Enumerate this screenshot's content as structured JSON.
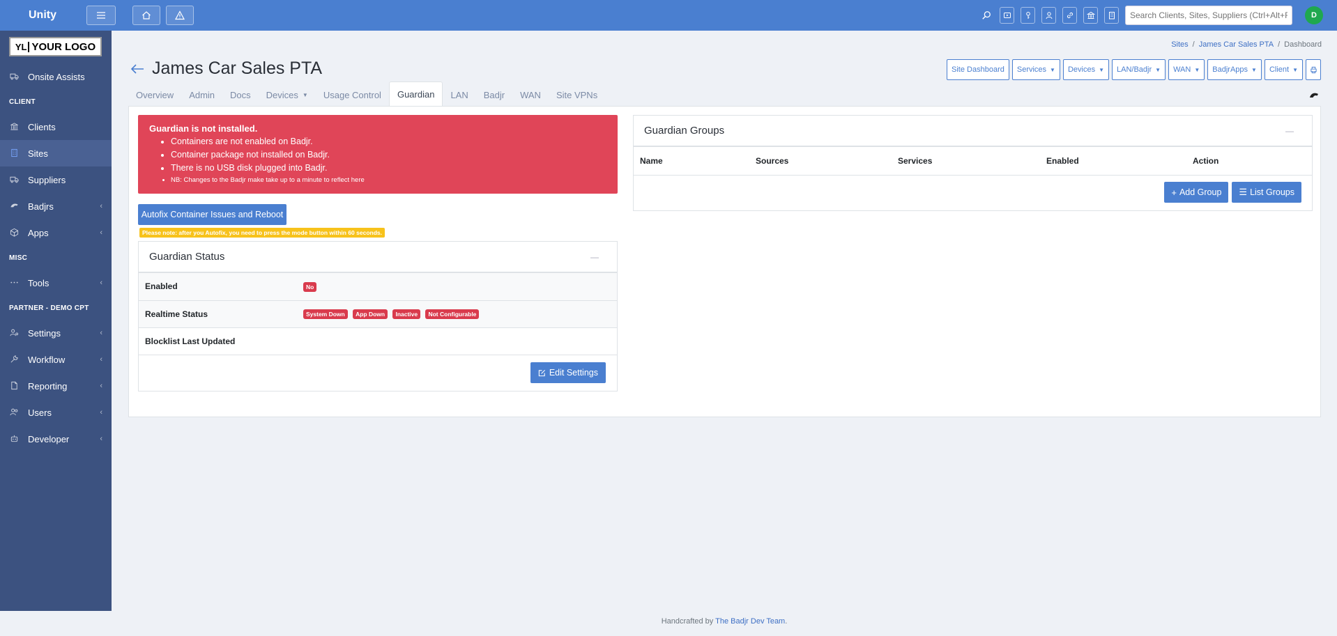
{
  "app": {
    "brand": "Unity"
  },
  "topbar": {
    "search_placeholder": "Search Clients, Sites, Suppliers (Ctrl+Alt+F)",
    "avatar_initial": "D"
  },
  "sidebar": {
    "logo_text": "YOUR LOGO",
    "logo_mark": "YL",
    "items": {
      "onsite_assists": "Onsite Assists",
      "header_client": "CLIENT",
      "clients": "Clients",
      "sites": "Sites",
      "suppliers": "Suppliers",
      "badjrs": "Badjrs",
      "apps": "Apps",
      "header_misc": "MISC",
      "tools": "Tools",
      "header_partner": "PARTNER - DEMO CPT",
      "settings": "Settings",
      "workflow": "Workflow",
      "reporting": "Reporting",
      "users": "Users",
      "developer": "Developer"
    }
  },
  "breadcrumb": {
    "sites": "Sites",
    "sep1": "/",
    "site": "James Car Sales PTA",
    "sep2": "/",
    "current": "Dashboard"
  },
  "page": {
    "title": "James Car Sales PTA"
  },
  "header_buttons": {
    "site_dashboard": "Site Dashboard",
    "services": "Services",
    "devices": "Devices",
    "lan_badjr": "LAN/Badjr",
    "wan": "WAN",
    "badjr_apps": "BadjrApps",
    "client": "Client"
  },
  "tabs": {
    "overview": "Overview",
    "admin": "Admin",
    "docs": "Docs",
    "devices": "Devices",
    "usage_control": "Usage Control",
    "guardian": "Guardian",
    "lan": "LAN",
    "badjr": "Badjr",
    "wan": "WAN",
    "site_vpns": "Site VPNs"
  },
  "alert": {
    "title": "Guardian is not installed.",
    "items": [
      "Containers are not enabled on Badjr.",
      "Container package not installed on Badjr.",
      "There is no USB disk plugged into Badjr."
    ],
    "note": "NB: Changes to the Badjr make take up to a minute to reflect here"
  },
  "autofix": {
    "button": "Autofix Container Issues and Reboot",
    "note": "Please note: after you Autofix, you need to press the mode button within 60 seconds."
  },
  "status_panel": {
    "title": "Guardian Status",
    "collapse": "—",
    "rows": {
      "enabled_label": "Enabled",
      "enabled_value": "No",
      "realtime_label": "Realtime Status",
      "realtime_badges": [
        "System Down",
        "App Down",
        "Inactive",
        "Not Configurable"
      ],
      "blocklist_label": "Blocklist Last Updated"
    },
    "edit_button": "Edit Settings"
  },
  "groups_panel": {
    "title": "Guardian Groups",
    "collapse": "—",
    "columns": [
      "Name",
      "Sources",
      "Services",
      "Enabled",
      "Action"
    ],
    "add_button": "Add Group",
    "list_button": "List Groups"
  },
  "footer": {
    "prefix": "Handcrafted by",
    "link": "The Badjr Dev Team",
    "suffix": "."
  }
}
